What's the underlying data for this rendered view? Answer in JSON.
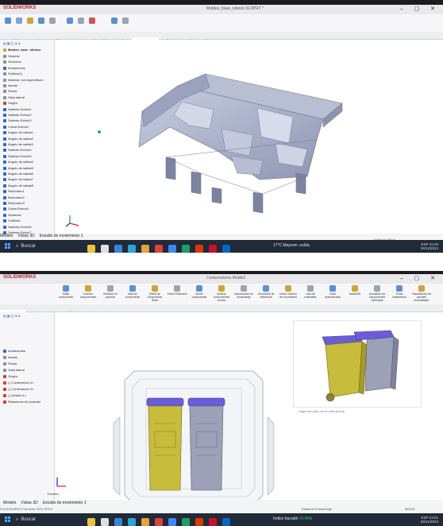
{
  "photo1": {
    "app_brand": "SOLIDWORKS",
    "window_title": "Moldeo_base_inferior.SLDPRT *",
    "tabs": [
      {
        "label": "Ensamblaje",
        "active": false
      },
      {
        "label": "Croquis",
        "active": false
      },
      {
        "label": "Superficies",
        "active": false
      },
      {
        "label": "Herramientas de moldes",
        "active": false
      },
      {
        "label": "Evaluar",
        "active": false
      },
      {
        "label": "Editor directo",
        "active": true
      },
      {
        "label": "Calidad",
        "active": false
      },
      {
        "label": "Complementos de SOLIDWORKS",
        "active": false
      },
      {
        "label": "MBD",
        "active": false
      }
    ],
    "tree": {
      "root": "Moldeo_base_inferior",
      "items": [
        {
          "label": "Historial",
          "color": "#8a8f99"
        },
        {
          "label": "Sensores",
          "color": "#8a8f99"
        },
        {
          "label": "Anotaciones",
          "color": "#2a66c7"
        },
        {
          "label": "Sólidos(1)",
          "color": "#8a8f99"
        },
        {
          "label": "Material <sin especificar>",
          "color": "#8a8f99"
        },
        {
          "label": "Alzado",
          "color": "#8a8f99"
        },
        {
          "label": "Planta",
          "color": "#8a8f99"
        },
        {
          "label": "Vista lateral",
          "color": "#8a8f99"
        },
        {
          "label": "Origen",
          "color": "#c2452d"
        },
        {
          "label": "Saliente-Extruir1",
          "color": "#2a66c7"
        },
        {
          "label": "Saliente-Extruir2",
          "color": "#2a66c7"
        },
        {
          "label": "Saliente-Extruir3",
          "color": "#2a66c7"
        },
        {
          "label": "Cortar-Extruir1",
          "color": "#2a66c7"
        },
        {
          "label": "Ángulo de salida1",
          "color": "#2a66c7"
        },
        {
          "label": "Ángulo de salida2",
          "color": "#2a66c7"
        },
        {
          "label": "Ángulo de salida3",
          "color": "#2a66c7"
        },
        {
          "label": "Saliente-Extruir4",
          "color": "#2a66c7"
        },
        {
          "label": "Saliente-Extruir5",
          "color": "#2a66c7"
        },
        {
          "label": "Ángulo de salida4",
          "color": "#2a66c7"
        },
        {
          "label": "Ángulo de salida5",
          "color": "#2a66c7"
        },
        {
          "label": "Ángulo de salida6",
          "color": "#2a66c7"
        },
        {
          "label": "Ángulo de salida7",
          "color": "#2a66c7"
        },
        {
          "label": "Ángulo de salida8",
          "color": "#2a66c7"
        },
        {
          "label": "Redondeo1",
          "color": "#2a66c7"
        },
        {
          "label": "Redondeo2",
          "color": "#2a66c7"
        },
        {
          "label": "Redondeo3",
          "color": "#2a66c7"
        },
        {
          "label": "Cortar-Extruir2",
          "color": "#2a66c7"
        },
        {
          "label": "Simetría1",
          "color": "#2a66c7"
        },
        {
          "label": "Chaflán1",
          "color": "#2a66c7"
        },
        {
          "label": "Saliente-Extruir6",
          "color": "#2a66c7"
        },
        {
          "label": "Saliente-Extruir7",
          "color": "#2a66c7"
        }
      ]
    },
    "bottom_tabs": [
      "Modelo",
      "Vistas 3D",
      "Estudio de movimiento 1"
    ],
    "status": "SOLIDWORKS Premium 2024 SP3.0",
    "status_right": "Editando Pieza",
    "search_label": "Buscar",
    "weather": "17°C  Mayorm. nubla",
    "tray_time": "22:45",
    "tray_date": "26/11/2024",
    "tray_lang": "ESP"
  },
  "photo2": {
    "app_brand": "SOLIDWORKS",
    "window_title": "Contenedores Molde2",
    "ribbon_labels": [
      "Editar componente",
      "Insertar componentes",
      "Relación de posición",
      "Vista de componente",
      "Matriz de componente lineal",
      "Smart Fasteners",
      "Mover componente",
      "Mostrar componentes ocultos",
      "Operaciones de ensamblaje",
      "Geometría de referencia",
      "Nuevo estudio de movimiento",
      "Lista de materiales",
      "Vista explosionada",
      "Instant3D",
      "Actualizar los componentes Speedpak",
      "Tomar instantánea",
      "Visualización de grandes ensamblajes"
    ],
    "tabs": [
      {
        "label": "Ensamblaje",
        "active": true
      },
      {
        "label": "Croquis",
        "active": false
      },
      {
        "label": "Evaluar",
        "active": false
      },
      {
        "label": "Cálculo",
        "active": false
      },
      {
        "label": "Complementos de SOLIDWORKS",
        "active": false
      },
      {
        "label": "MBD",
        "active": false
      }
    ],
    "tree": {
      "items": [
        {
          "label": "Anotaciones",
          "color": "#2a66c7"
        },
        {
          "label": "Alzado",
          "color": "#8a8f99"
        },
        {
          "label": "Planta",
          "color": "#8a8f99"
        },
        {
          "label": "Vista lateral",
          "color": "#8a8f99"
        },
        {
          "label": "Origen",
          "color": "#c2452d"
        },
        {
          "label": "(-) Contenedor<1>",
          "color": "#d63a2a"
        },
        {
          "label": "(-) Contenedor<2>",
          "color": "#d63a2a"
        },
        {
          "label": "(-) Molde<1>",
          "color": "#d63a2a"
        },
        {
          "label": "Relaciones de posición",
          "color": "#d63a2a"
        }
      ]
    },
    "preview_hint": "Haga clic para ver la vista previa",
    "axis_label": "Trimetric",
    "bottom_tabs": [
      "Modelo",
      "Vistas 3D",
      "Estudio de movimiento 1"
    ],
    "status": "SOLIDWORKS Premium 2024 SP3.0",
    "status_mid": "Definido",
    "status_right": "Editando Ensamblaje",
    "status_units": "MMGS",
    "search_label": "Buscar",
    "weather": "Índice bursátil",
    "weather_change": "+0,45%",
    "tray_time": "23:01",
    "tray_date": "26/11/2024",
    "tray_lang": "ESP"
  },
  "colors": {
    "model_gray": "#a9b0c8",
    "bin_olive": "#c8bc3c",
    "bin_gray": "#9ca1b8",
    "lid_purple": "#6a5ed8",
    "taskbar": "#202a38"
  },
  "icons": [
    "windows-start-icon",
    "search-icon",
    "close-icon",
    "axis-triad-icon"
  ]
}
